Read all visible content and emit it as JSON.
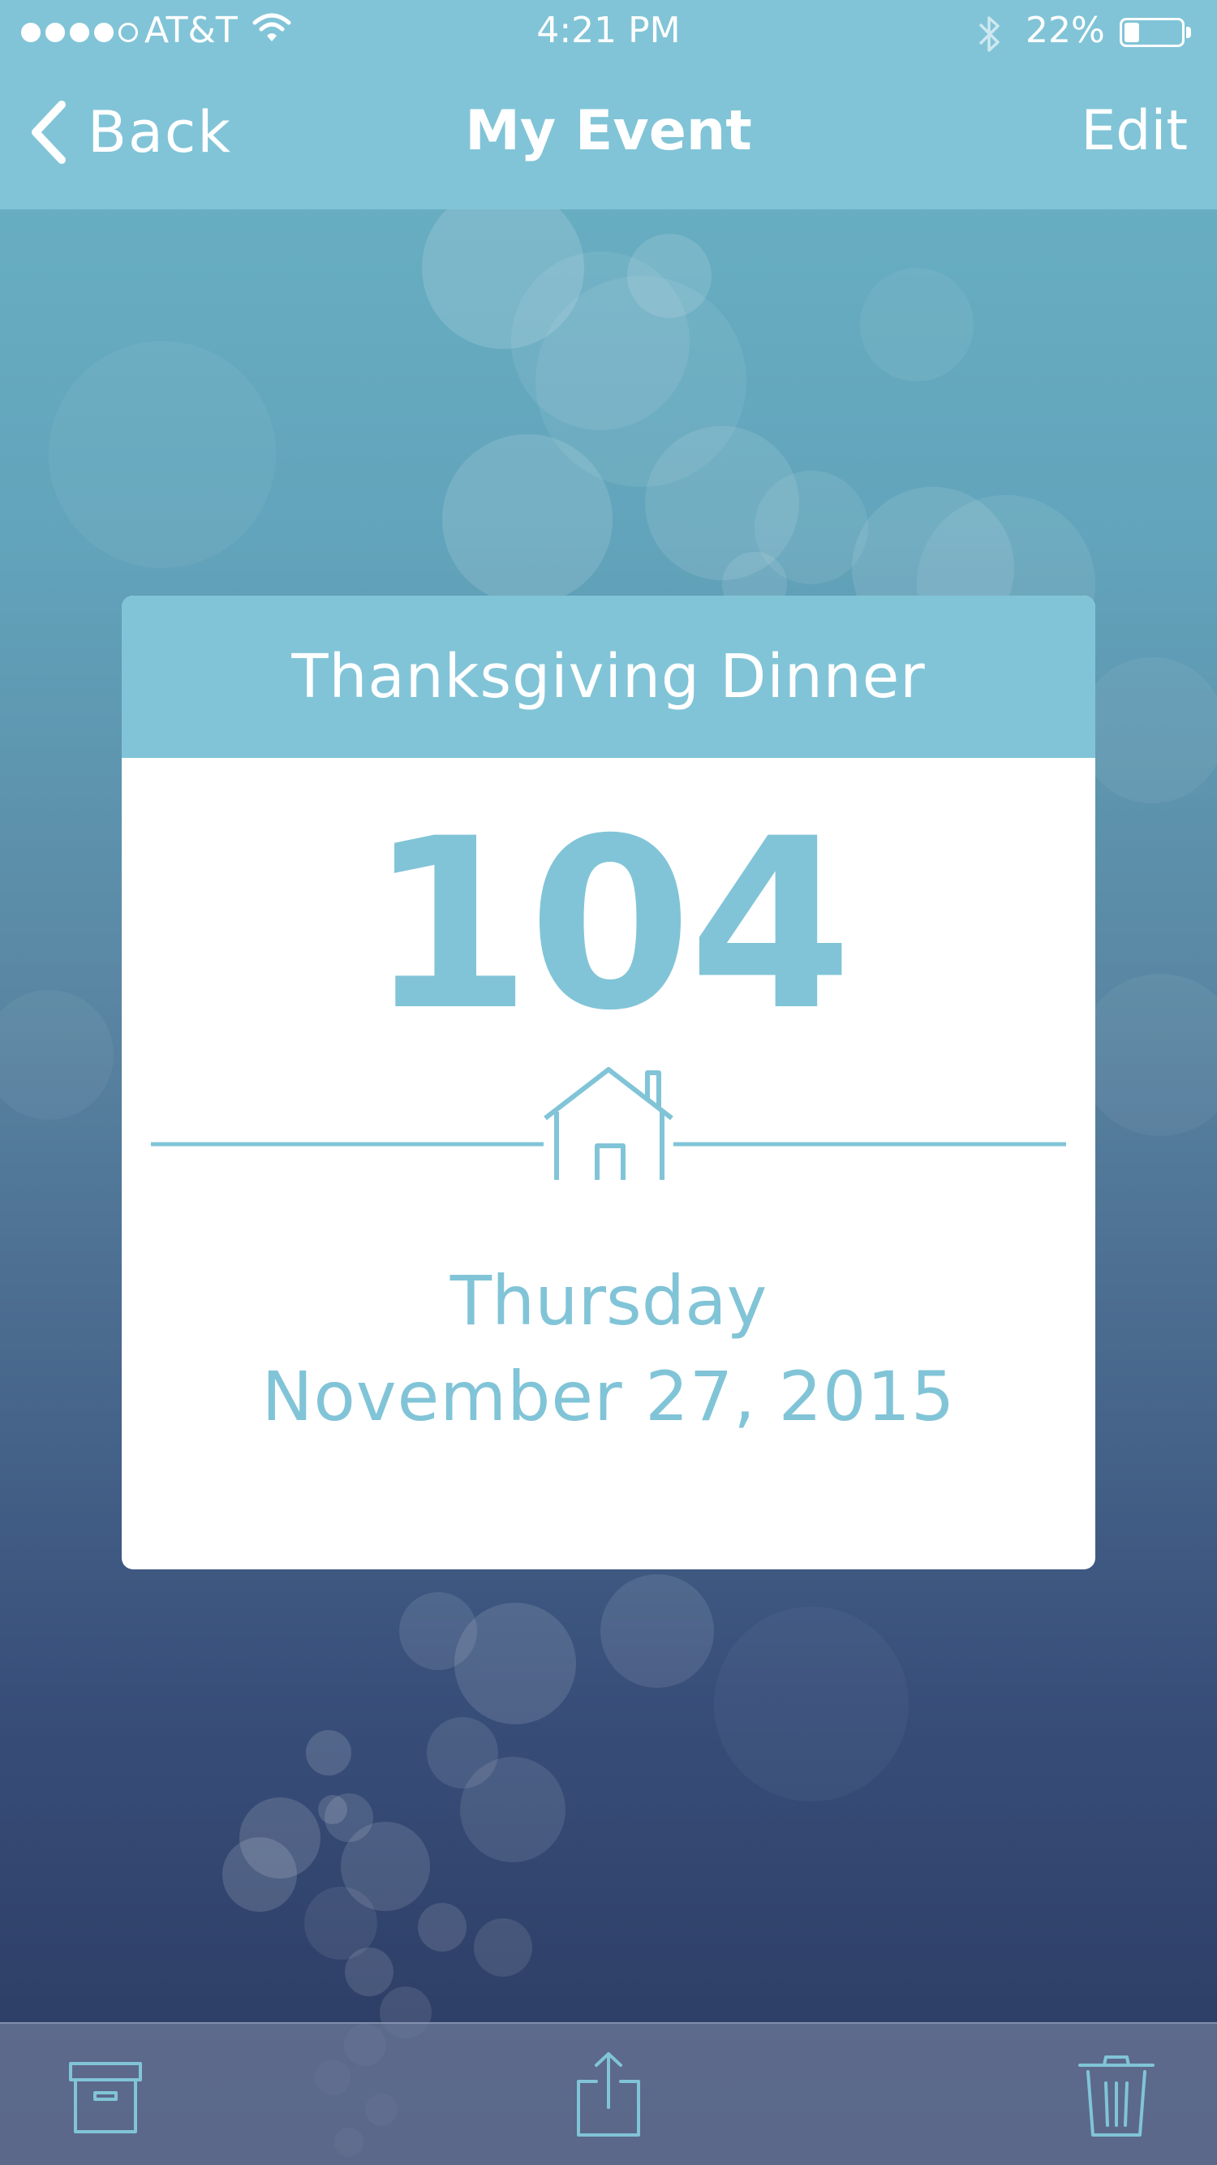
{
  "status_bar": {
    "signal_bars_filled": 4,
    "signal_bars_total": 5,
    "carrier": "AT&T",
    "time": "4:21 PM",
    "battery_percent": "22%",
    "battery_level": 0.22,
    "icons": [
      "wifi-icon",
      "bluetooth-icon",
      "battery-icon"
    ]
  },
  "nav": {
    "back_label": "Back",
    "title": "My Event",
    "edit_label": "Edit"
  },
  "event": {
    "name": "Thanksgiving Dinner",
    "count": "104",
    "icon": "house-icon",
    "weekday": "Thursday",
    "date": "November 27, 2015"
  },
  "toolbar": {
    "items": [
      "archive-icon",
      "share-icon",
      "trash-icon"
    ]
  },
  "colors": {
    "accent": "#81c4d7",
    "card": "#ffffff",
    "toolbar": "#697696"
  }
}
